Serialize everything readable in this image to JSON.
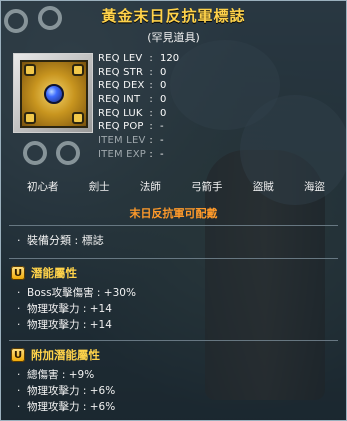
{
  "tooltip": {
    "title": "黃金末日反抗軍標誌",
    "subtitle": "(罕見道具)",
    "requirements": [
      {
        "label": "REQ LEV",
        "sep": ":",
        "value": "120",
        "dim": false
      },
      {
        "label": "REQ STR",
        "sep": ":",
        "value": "0",
        "dim": false
      },
      {
        "label": "REQ DEX",
        "sep": ":",
        "value": "0",
        "dim": false
      },
      {
        "label": "REQ INT",
        "sep": ":",
        "value": "0",
        "dim": false
      },
      {
        "label": "REQ LUK",
        "sep": ":",
        "value": "0",
        "dim": false
      },
      {
        "label": "REQ POP",
        "sep": ":",
        "value": "-",
        "dim": false
      },
      {
        "label": "ITEM LEV",
        "sep": ":",
        "value": "-",
        "dim": true
      },
      {
        "label": "ITEM EXP",
        "sep": ":",
        "value": "-",
        "dim": true
      }
    ],
    "jobs": [
      "初心者",
      "劍士",
      "法師",
      "弓箭手",
      "盜賊",
      "海盜"
    ],
    "equip_banner": "末日反抗軍可配戴",
    "equipment_category": "裝備分類 : 標誌",
    "potential": {
      "badge": "U",
      "heading": "潛能屬性",
      "lines": [
        "Boss攻擊傷害 : +30%",
        "物理攻擊力 : +14",
        "物理攻擊力 : +14"
      ]
    },
    "additional_potential": {
      "badge": "U",
      "heading": "附加潛能屬性",
      "lines": [
        "總傷害 : +9%",
        "物理攻擊力 : +6%",
        "物理攻擊力 : +6%"
      ]
    }
  },
  "colors": {
    "title": "#ffd24a",
    "banner": "#ff9a2a",
    "section_heading": "#ffd34a"
  }
}
